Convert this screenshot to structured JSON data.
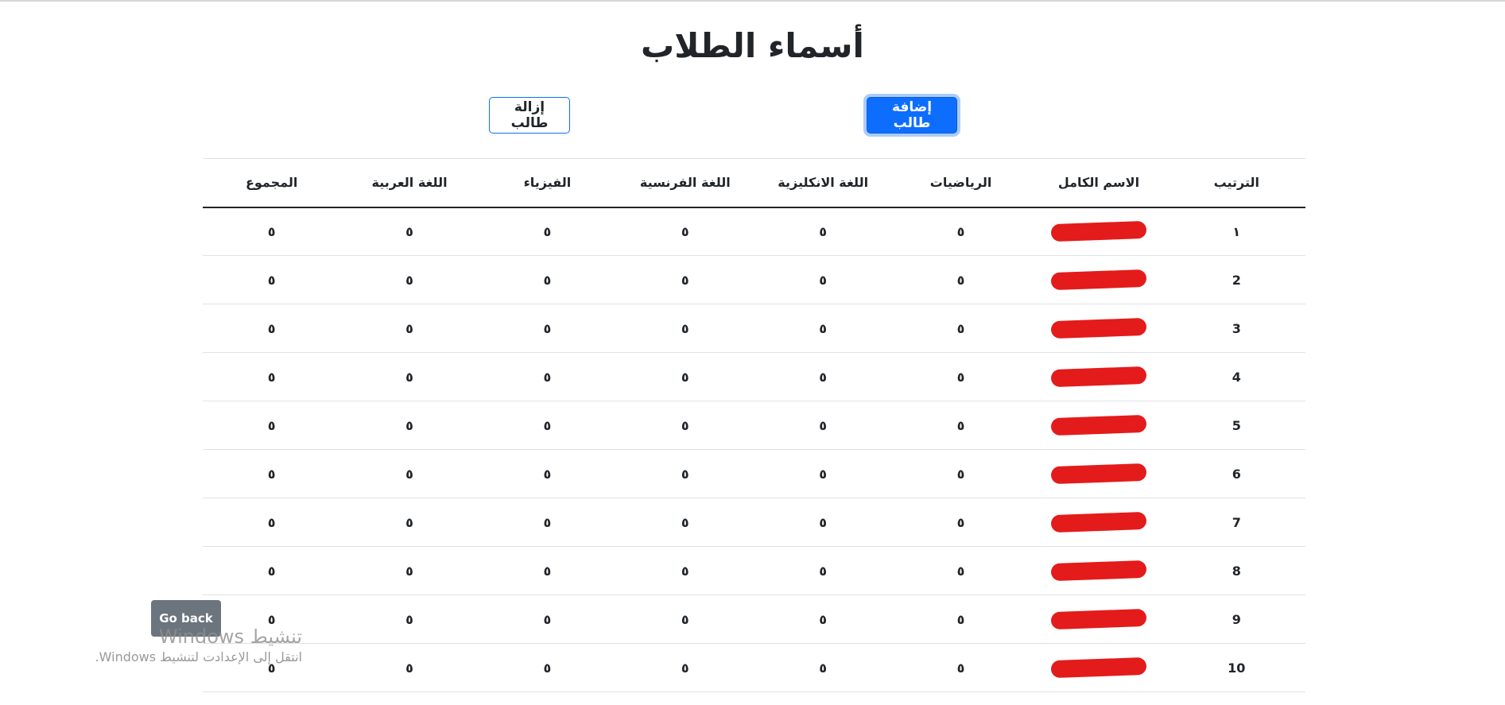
{
  "page": {
    "title": "أسماء الطلاب"
  },
  "toolbar": {
    "add_label": "إضافة طالب",
    "remove_label": "إزالة طالب"
  },
  "table": {
    "headers": [
      "الترتيب",
      "الاسم الكامل",
      "الرياضيات",
      "اللغة الانكليزية",
      "اللغة الفرنسية",
      "الفيزياء",
      "اللغة العربية",
      "المجموع"
    ],
    "rows": [
      [
        "١",
        "",
        "٥",
        "٥",
        "٥",
        "٥",
        "٥",
        "٥"
      ],
      [
        "2",
        "",
        "٥",
        "٥",
        "٥",
        "٥",
        "٥",
        "٥"
      ],
      [
        "3",
        "",
        "٥",
        "٥",
        "٥",
        "٥",
        "٥",
        "٥"
      ],
      [
        "4",
        "",
        "٥",
        "٥",
        "٥",
        "٥",
        "٥",
        "٥"
      ],
      [
        "5",
        "",
        "٥",
        "٥",
        "٥",
        "٥",
        "٥",
        "٥"
      ],
      [
        "6",
        "",
        "٥",
        "٥",
        "٥",
        "٥",
        "٥",
        "٥"
      ],
      [
        "7",
        "",
        "٥",
        "٥",
        "٥",
        "٥",
        "٥",
        "٥"
      ],
      [
        "8",
        "",
        "٥",
        "٥",
        "٥",
        "٥",
        "٥",
        "٥"
      ],
      [
        "9",
        "",
        "٥",
        "٥",
        "٥",
        "٥",
        "٥",
        "٥"
      ],
      [
        "10",
        "",
        "٥",
        "٥",
        "٥",
        "٥",
        "٥",
        "٥"
      ]
    ]
  },
  "footer": {
    "go_back_label": "Go back"
  },
  "watermark": {
    "title": "تنشيط Windows",
    "subtitle": "انتقل إلى الإعدادت لتنشيط Windows."
  },
  "colors": {
    "primary": "#0d6efd",
    "secondary": "#6c757d",
    "redaction": "#e41b1b"
  }
}
